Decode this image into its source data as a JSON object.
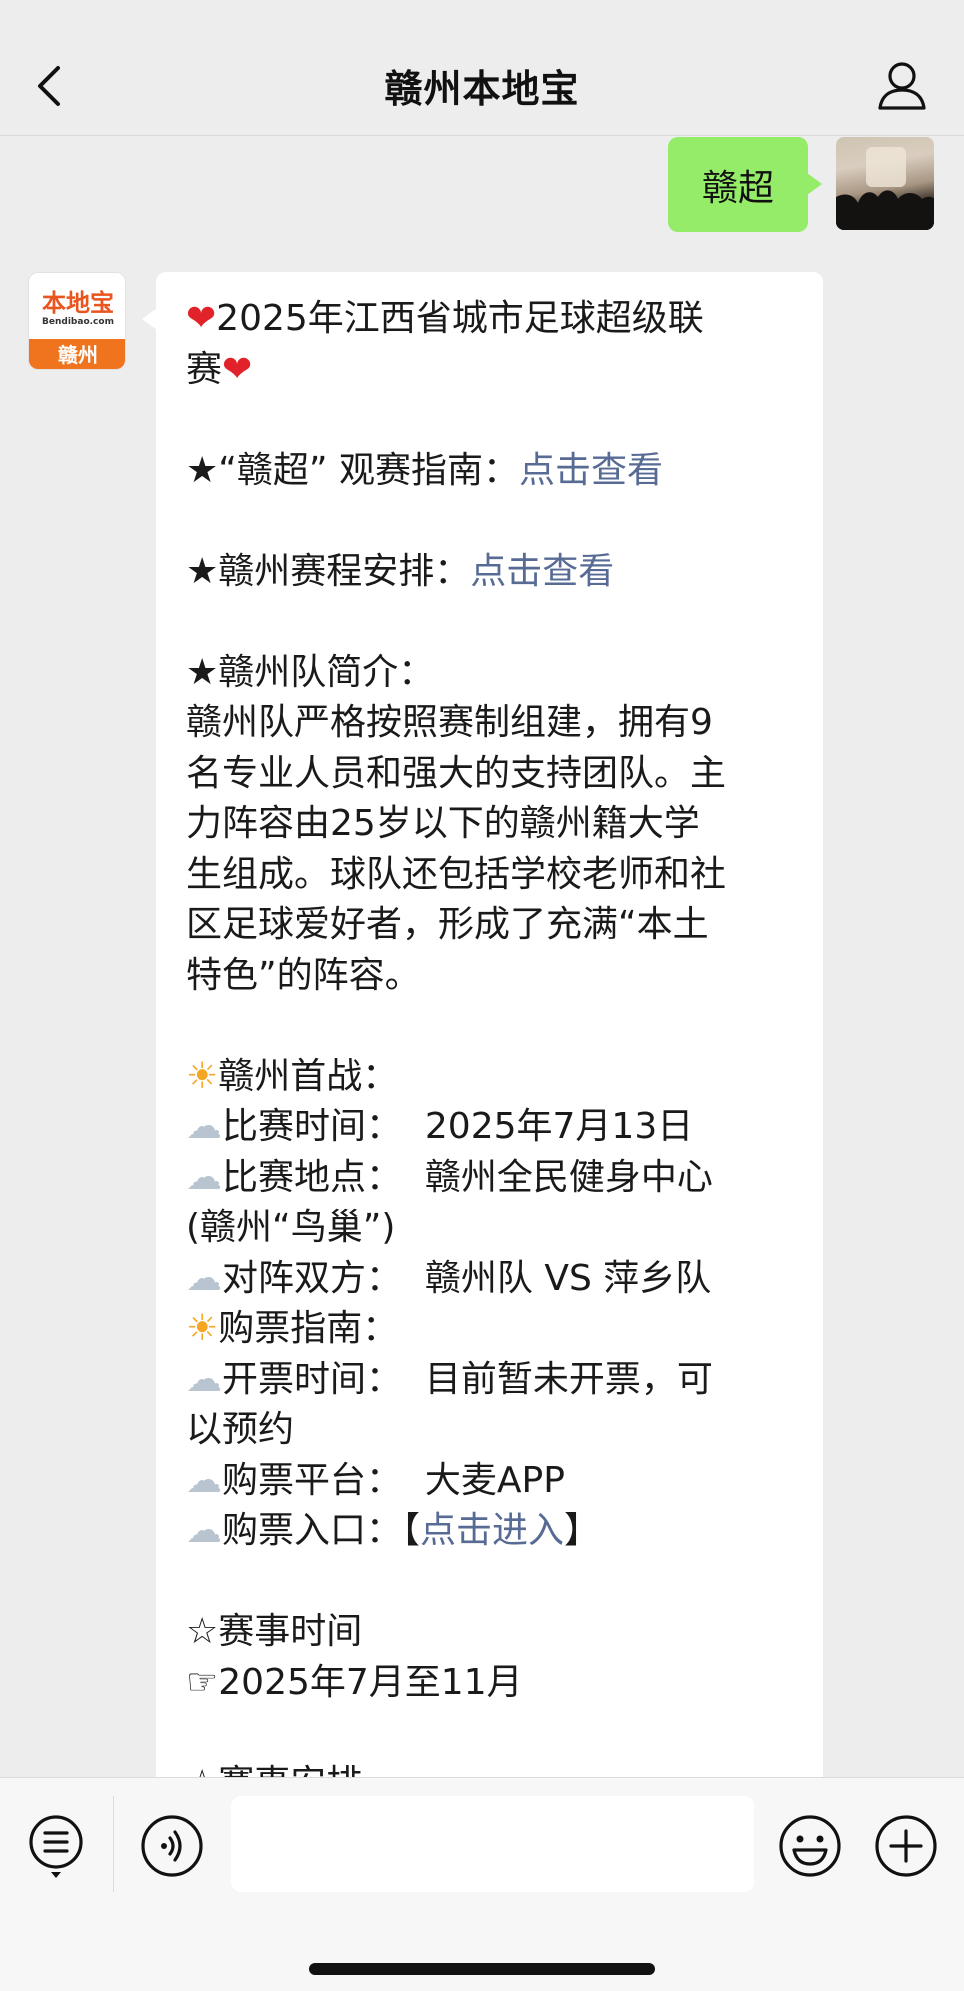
{
  "header": {
    "title": "赣州本地宝",
    "back_icon": "chevron-left-icon",
    "profile_icon": "person-icon"
  },
  "sent_message": {
    "text": "赣超"
  },
  "bot_avatar": {
    "logo_text": "本地宝",
    "logo_url": "Bendibao.com",
    "city": "赣州"
  },
  "message": {
    "title_line1": "2025年江西省城市足球超级联",
    "title_line2": "赛",
    "guide_prefix": "★“赣超” 观赛指南：",
    "guide_link": "点击查看",
    "schedule_prefix": "★赣州赛程安排：",
    "schedule_link": "点击查看",
    "team_heading": "★赣州队简介：",
    "team_text": [
      "赣州队严格按照赛制组建，拥有9",
      "名专业人员和强大的支持团队。主",
      "力阵容由25岁以下的赣州籍大学",
      "生组成。球队还包括学校老师和社",
      "区足球爱好者，形成了充满“本土",
      "特色”的阵容。"
    ],
    "first_match_heading": "赣州首战：",
    "match_time": "比赛时间：  2025年7月13日",
    "match_venue_1": "比赛地点：  赣州全民健身中心",
    "match_venue_2": "(赣州“鸟巢”)",
    "match_teams": "对阵双方：  赣州队 VS 萍乡队",
    "ticket_heading": "购票指南：",
    "ticket_open_1": "开票时间：  目前暂未开票，可",
    "ticket_open_2": "以预约",
    "ticket_platform": "购票平台：  大麦APP",
    "ticket_entry_prefix": "购票入口：【",
    "ticket_entry_link": "点击进入",
    "ticket_entry_suffix": "】",
    "event_time_heading": "☆赛事时间",
    "event_time_value": "☞2025年7月至11月",
    "event_schedule_heading": "☆赛事安排"
  },
  "emoji": {
    "heart": "❤",
    "sun": "☀",
    "cloud": "☁"
  },
  "toolbar": {
    "menu_icon": "list-menu-icon",
    "voice_icon": "voice-icon",
    "emoji_icon": "smiley-icon",
    "plus_icon": "plus-icon"
  },
  "colors": {
    "link": "#576b95",
    "sent_bubble": "#95ec69",
    "brand_orange": "#f0731e"
  }
}
